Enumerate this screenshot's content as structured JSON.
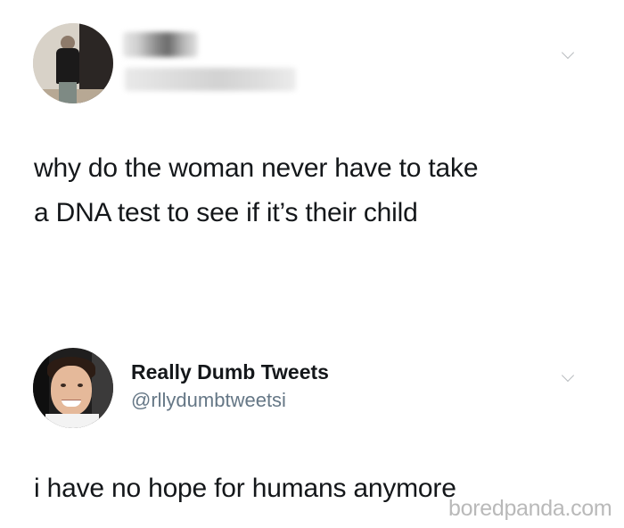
{
  "tweets": [
    {
      "author_name": "",
      "author_handle": "",
      "author_blurred": true,
      "text_lines": [
        "why do the woman never have to take",
        "a DNA test to see if it’s their child"
      ]
    },
    {
      "author_name": "Really Dumb Tweets",
      "author_handle": "@rllydumbtweetsi",
      "author_blurred": false,
      "text": "i have no hope for humans anymore"
    }
  ],
  "icons": {
    "menu_chevron": "chevron-down-icon"
  },
  "colors": {
    "text": "#14171a",
    "handle": "#657786",
    "chevron": "#b9bcc0",
    "watermark": "#b4b4b4"
  },
  "watermark": "boredpanda.com"
}
